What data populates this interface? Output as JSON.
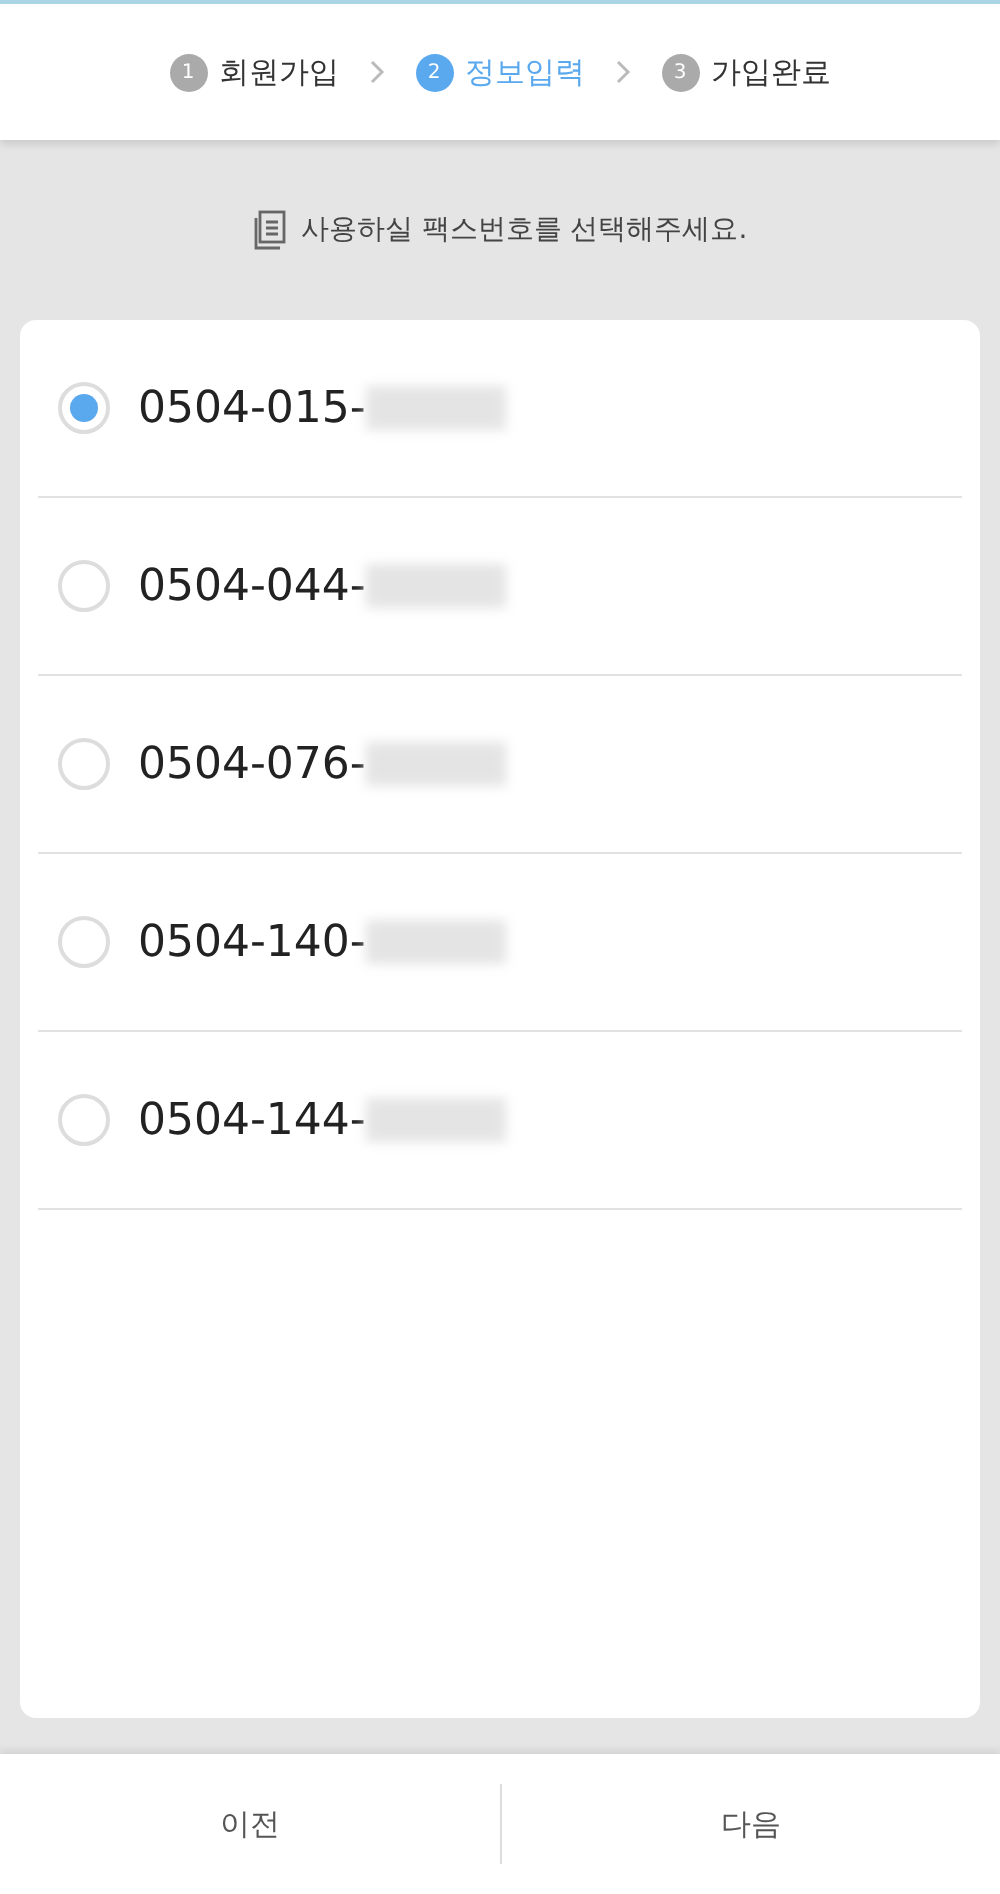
{
  "steps": [
    {
      "number": "1",
      "label": "회원가입",
      "selected": false
    },
    {
      "number": "2",
      "label": "정보입력",
      "selected": true
    },
    {
      "number": "3",
      "label": "가입완료",
      "selected": false
    }
  ],
  "instruction": "사용하실 팩스번호를 선택해주세요.",
  "options": [
    {
      "number": "0504-015-",
      "selected": true
    },
    {
      "number": "0504-044-",
      "selected": false
    },
    {
      "number": "0504-076-",
      "selected": false
    },
    {
      "number": "0504-140-",
      "selected": false
    },
    {
      "number": "0504-144-",
      "selected": false
    }
  ],
  "buttons": [
    "이전",
    "다음"
  ]
}
